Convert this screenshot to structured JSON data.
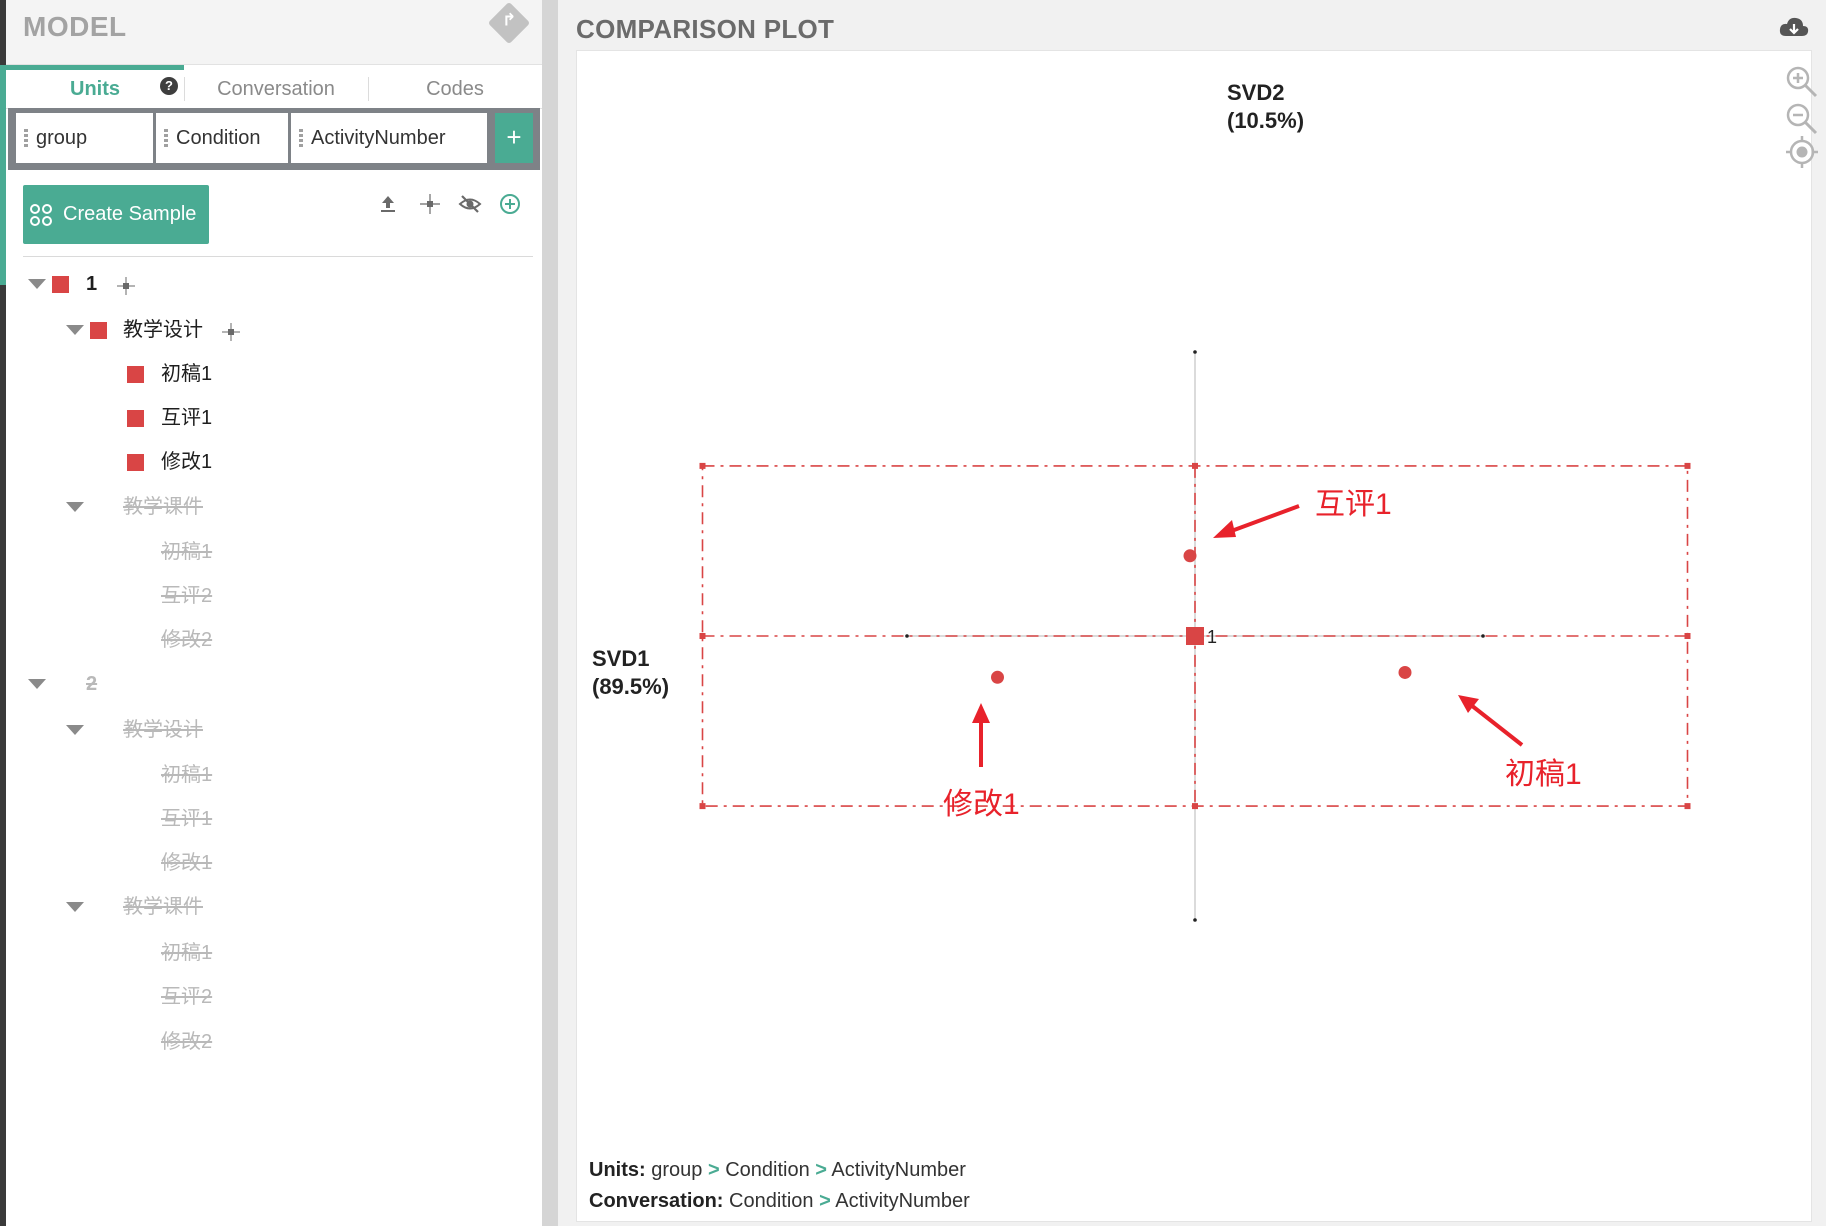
{
  "model": {
    "title": "MODEL",
    "tabs": [
      {
        "label": "Units"
      },
      {
        "label": "Conversation"
      },
      {
        "label": "Codes"
      }
    ],
    "help_icon": "?",
    "units": [
      "group",
      "Condition",
      "ActivityNumber"
    ],
    "add_unit_label": "+",
    "create_sample_label": "Create Sample",
    "toolbar_icons": [
      "upload-icon",
      "center-target-icon",
      "hide-eye-icon",
      "add-circle-icon"
    ],
    "tree": {
      "group1": {
        "label": "1",
        "color": "#d94545"
      },
      "group1_cond1": {
        "label": "教学设计",
        "items": [
          "初稿1",
          "互评1",
          "修改1"
        ]
      },
      "group1_cond2": {
        "label": "教学课件",
        "items": [
          "初稿1",
          "互评2",
          "修改2"
        ]
      },
      "group2": {
        "label": "2"
      },
      "group2_cond1": {
        "label": "教学设计",
        "items": [
          "初稿1",
          "互评1",
          "修改1"
        ]
      },
      "group2_cond2": {
        "label": "教学课件",
        "items": [
          "初稿1",
          "互评2",
          "修改2"
        ]
      }
    }
  },
  "plot": {
    "title": "COMPARISON PLOT",
    "svd2_label": "SVD2",
    "svd2_pct": "(10.5%)",
    "svd1_label": "SVD1",
    "svd1_pct": "(89.5%)",
    "mean_label": "1",
    "annotations": [
      "互评1",
      "修改1",
      "初稿1"
    ],
    "accent_color": "#d94545",
    "annotation_color": "#e8222b",
    "footer": {
      "units_key": "Units:",
      "units_path": [
        "group",
        "Condition",
        "ActivityNumber"
      ],
      "conversation_key": "Conversation:",
      "conversation_path": [
        "Condition",
        "ActivityNumber"
      ],
      "separator": ">"
    }
  },
  "chart_data": {
    "type": "scatter",
    "xlabel": "SVD1 (89.5%)",
    "ylabel": "SVD2 (10.5%)",
    "points": [
      {
        "label": "互评1",
        "x": -0.02,
        "y": 0.33
      },
      {
        "label": "修改1",
        "x": -0.79,
        "y": -0.17
      },
      {
        "label": "初稿1",
        "x": 0.84,
        "y": -0.15
      }
    ],
    "mean": {
      "label": "1",
      "x": 0,
      "y": 0
    },
    "confidence_box": {
      "x": [
        -1.97,
        1.97
      ],
      "y": [
        -0.7,
        0.7
      ]
    }
  }
}
